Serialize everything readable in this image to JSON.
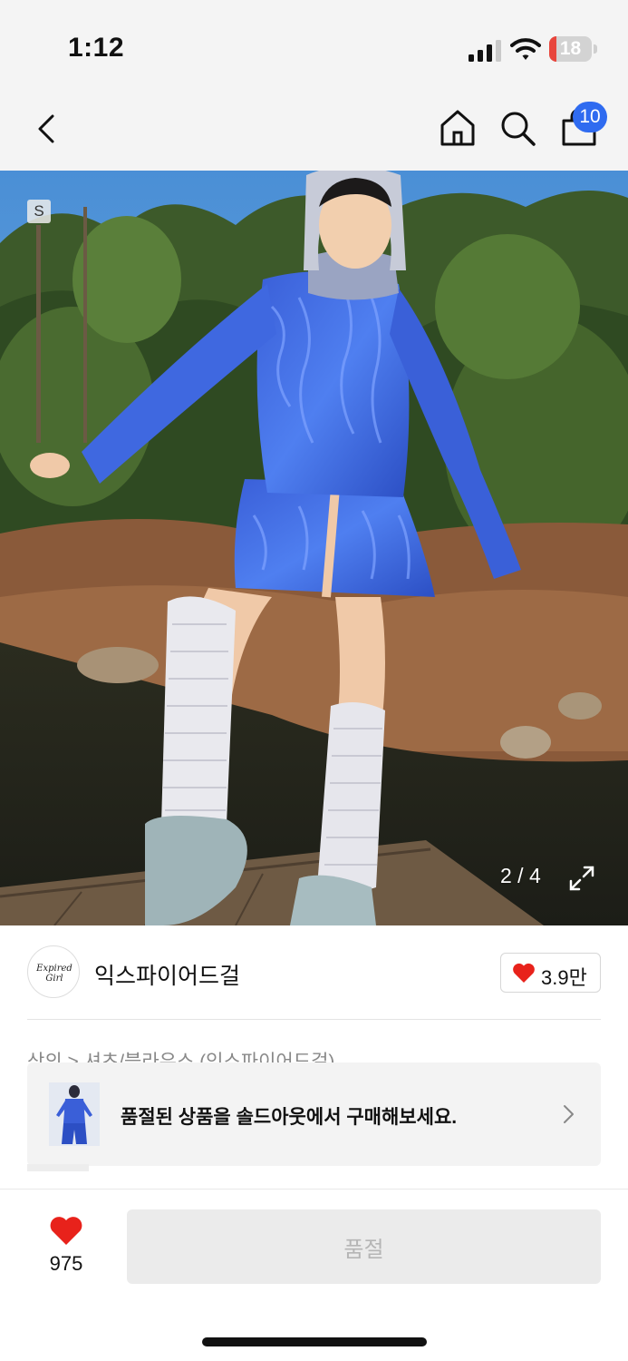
{
  "status_bar": {
    "time": "1:12",
    "battery_level": "18",
    "battery_fraction": 0.18,
    "battery_color": "#e8453c"
  },
  "nav": {
    "back_icon": "chevron-left-icon",
    "home_icon": "home-icon",
    "search_icon": "search-icon",
    "cart_icon": "shopping-bag-icon",
    "cart_badge": "10",
    "badge_color": "#2f6bf0"
  },
  "gallery": {
    "size_badge": "S",
    "counter": "2 / 4",
    "expand_icon": "expand-icon"
  },
  "brand": {
    "logo_text": "Expired Girl",
    "name": "익스파이어드걸",
    "like_count": "3.9만",
    "heart_color": "#e8221b"
  },
  "breadcrumb": "상의 > 셔츠/블라우스 (익스파이어드걸)",
  "soldout_banner": {
    "text": "품절된 상품을 솔드아웃에서 구매해보세요.",
    "chevron_icon": "chevron-right-icon"
  },
  "bottom_bar": {
    "wish_count": "975",
    "buy_label": "품절"
  }
}
